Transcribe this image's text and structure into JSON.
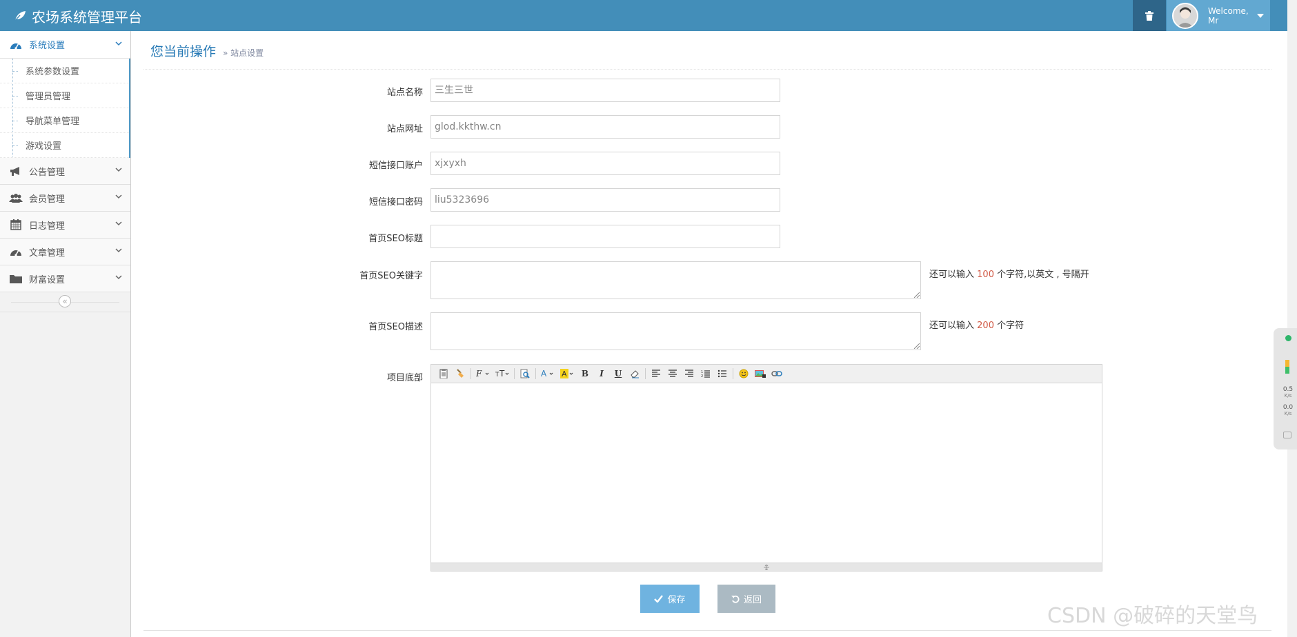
{
  "app": {
    "title": "农场系统管理平台",
    "welcome_line1": "Welcome,",
    "welcome_line2": "Mr"
  },
  "sidebar": {
    "active_group": "系统设置",
    "sub_items": [
      "系统参数设置",
      "管理员管理",
      "导航菜单管理",
      "游戏设置"
    ],
    "groups": [
      "公告管理",
      "会员管理",
      "日志管理",
      "文章管理",
      "财富设置"
    ]
  },
  "breadcrumb": {
    "main": "您当前操作",
    "sub": "» 站点设置"
  },
  "form": {
    "site_name_label": "站点名称",
    "site_name_value": "三生三世",
    "site_url_label": "站点网址",
    "site_url_value": "glod.kkthw.cn",
    "sms_account_label": "短信接口账户",
    "sms_account_value": "xjxyxh",
    "sms_password_label": "短信接口密码",
    "sms_password_value": "liu5323696",
    "seo_title_label": "首页SEO标题",
    "seo_title_value": "",
    "seo_keywords_label": "首页SEO关键字",
    "seo_keywords_hint_pre": "还可以输入",
    "seo_keywords_hint_num": "100",
    "seo_keywords_hint_post": "个字符,以英文 , 号隔开",
    "seo_desc_label": "首页SEO描述",
    "seo_desc_hint_pre": "还可以输入",
    "seo_desc_hint_num": "200",
    "seo_desc_hint_post": "个字符",
    "footer_label": "项目底部"
  },
  "buttons": {
    "save": "保存",
    "back": "返回"
  },
  "speed_widget": {
    "up_value": "0.5",
    "up_unit": "K/s",
    "down_value": "0.0",
    "down_unit": "K/s"
  },
  "watermark": "CSDN @破碎的天堂鸟",
  "colors": {
    "navbar": "#438eb9",
    "accent": "#2679b5",
    "save_button": "#6fb3e0",
    "back_button": "#abbac3",
    "hint_number": "#d15b47"
  }
}
